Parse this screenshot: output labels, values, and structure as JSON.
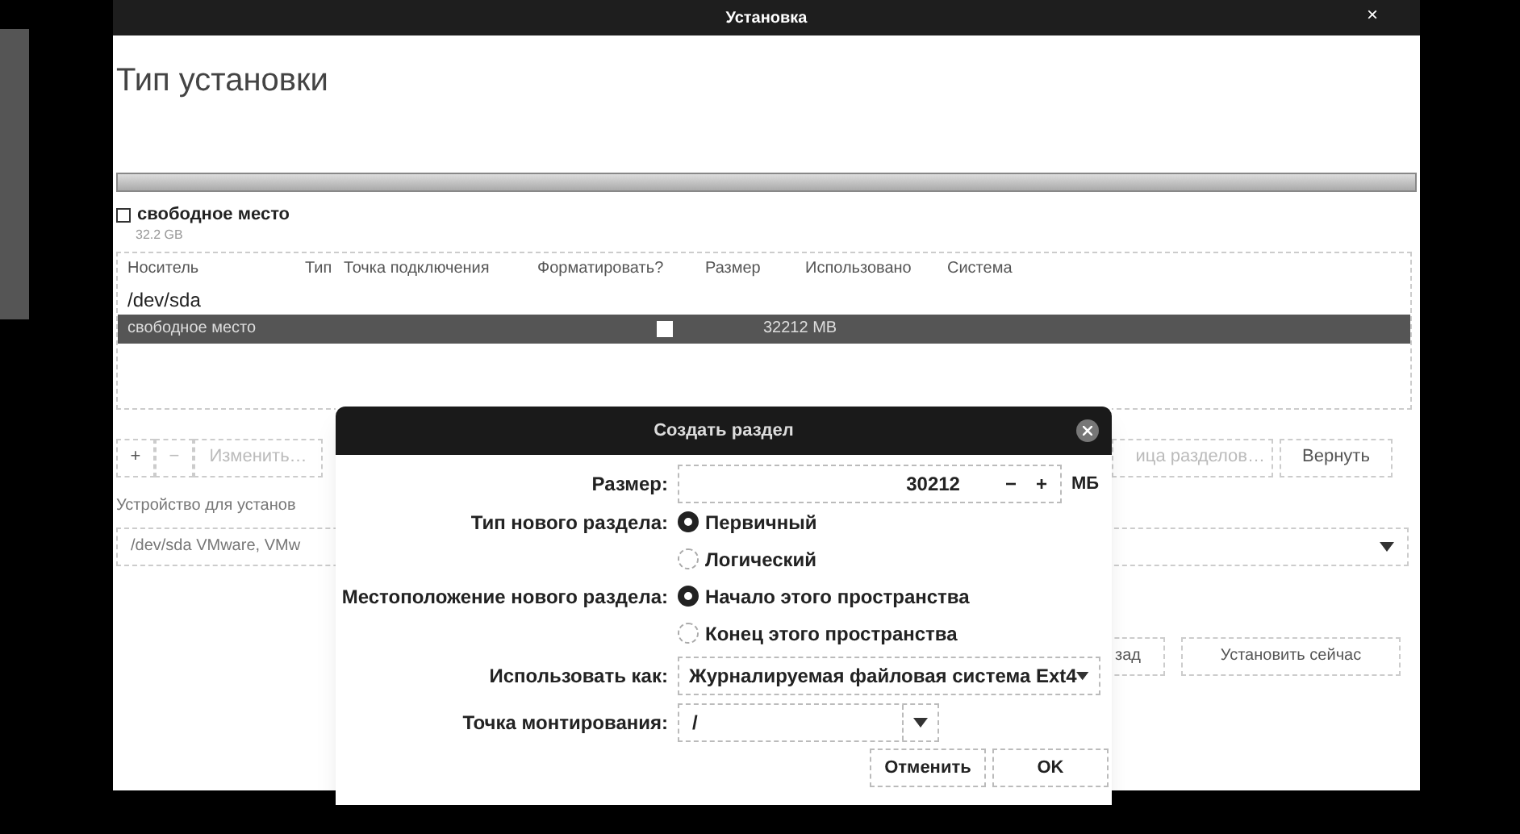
{
  "window": {
    "title": "Установка",
    "close": "×"
  },
  "heading": "Тип установки",
  "legend": {
    "label": "свободное место",
    "size": "32.2 GB",
    "checked": false
  },
  "table": {
    "columns": [
      "Носитель",
      "Тип",
      "Точка подключения",
      "Форматировать?",
      "Размер",
      "Использовано",
      "Система"
    ],
    "rows": [
      {
        "kind": "device",
        "name": "/dev/sda",
        "selected": false
      },
      {
        "kind": "partition",
        "name": "свободное место",
        "format_checked": false,
        "size": "32212 MB",
        "selected": true
      }
    ]
  },
  "toolbar": [
    {
      "label": "+",
      "disabled": false
    },
    {
      "label": "−",
      "disabled": true
    },
    {
      "label": "Изменить…",
      "disabled": true
    }
  ],
  "toolbar_right": [
    {
      "label": "ица разделов…",
      "disabled": true
    },
    {
      "label": "Вернуть",
      "disabled": false
    }
  ],
  "device_label": "Устройство для установ",
  "device_value": "/dev/sda VMware, VMw",
  "nav_buttons": [
    "зад",
    "Установить сейчас"
  ],
  "dialog": {
    "title": "Создать раздел",
    "size": {
      "label": "Размер:",
      "value": "30212",
      "minus": "−",
      "plus": "+",
      "unit": "МБ"
    },
    "type": {
      "label": "Тип нового раздела:",
      "options": [
        {
          "label": "Первичный",
          "selected": true
        },
        {
          "label": "Логический",
          "selected": false
        }
      ]
    },
    "location": {
      "label": "Местоположение нового раздела:",
      "options": [
        {
          "label": "Начало этого пространства",
          "selected": true
        },
        {
          "label": "Конец этого пространства",
          "selected": false
        }
      ]
    },
    "use_as": {
      "label": "Использовать как:",
      "value": "Журналируемая файловая система Ext4"
    },
    "mount": {
      "label": "Точка монтирования:",
      "value": "/"
    },
    "buttons": [
      "Отменить",
      "OK"
    ]
  }
}
